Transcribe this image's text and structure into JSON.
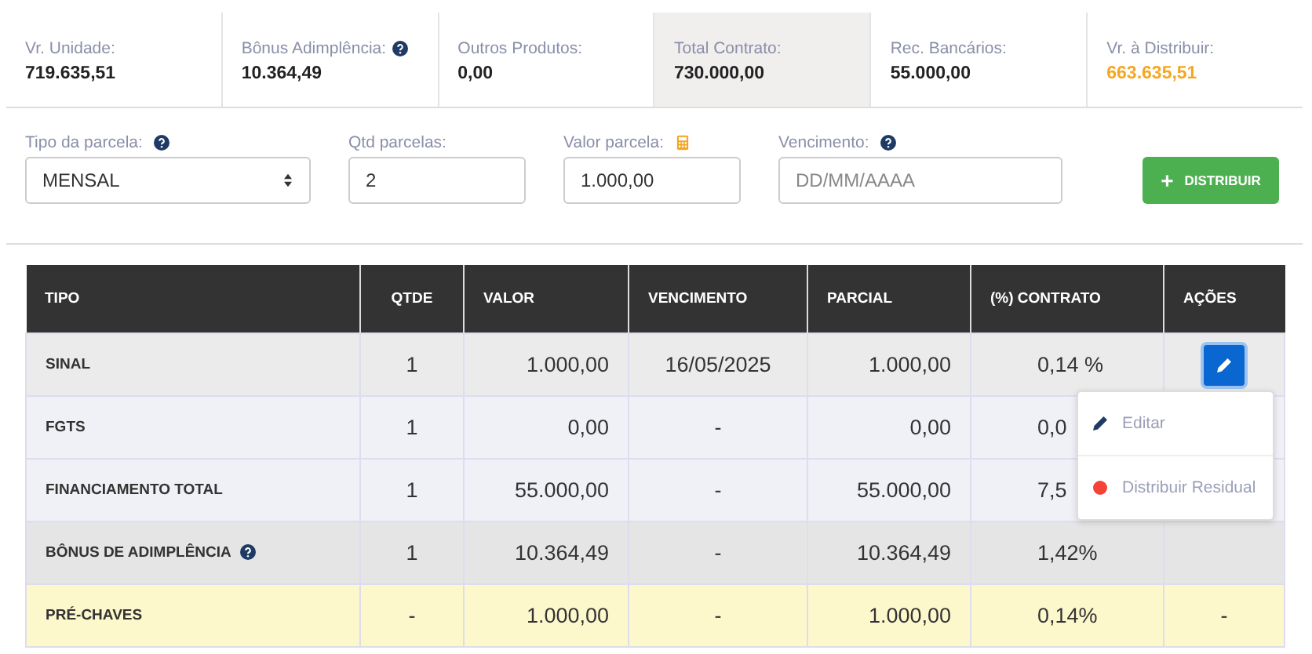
{
  "summary": [
    {
      "label": "Vr. Unidade:",
      "value": "719.635,51",
      "help": false,
      "shaded": false,
      "accent": false
    },
    {
      "label": "Bônus Adimplência:",
      "value": "10.364,49",
      "help": true,
      "shaded": false,
      "accent": false
    },
    {
      "label": "Outros Produtos:",
      "value": "0,00",
      "help": false,
      "shaded": false,
      "accent": false
    },
    {
      "label": "Total Contrato:",
      "value": "730.000,00",
      "help": false,
      "shaded": true,
      "accent": false
    },
    {
      "label": "Rec. Bancários:",
      "value": "55.000,00",
      "help": false,
      "shaded": false,
      "accent": false
    },
    {
      "label": "Vr. à Distribuir:",
      "value": "663.635,51",
      "help": false,
      "shaded": false,
      "accent": true
    }
  ],
  "form": {
    "fields": [
      {
        "kind": "select",
        "label": "Tipo da parcela:",
        "help": true,
        "value": "MENSAL"
      },
      {
        "kind": "input",
        "label": "Qtd parcelas:",
        "help": false,
        "value": "2"
      },
      {
        "kind": "money",
        "label": "Valor parcela:",
        "help": false,
        "value": "1.000,00"
      },
      {
        "kind": "input",
        "label": "Vencimento:",
        "help": true,
        "placeholder": "DD/MM/AAAA"
      }
    ],
    "button": {
      "glyph": "+",
      "label": "DISTRIBUIR"
    }
  },
  "table": {
    "columns": [
      "TIPO",
      "QTDE",
      "VALOR",
      "VENCIMENTO",
      "PARCIAL",
      "(%) CONTRATO",
      "AÇÕES"
    ],
    "rows": [
      {
        "help": false,
        "highlight": false,
        "cells": [
          "SINAL",
          "1",
          "1.000,00",
          "16/05/2025",
          "1.000,00",
          "0,14 %"
        ],
        "edit": {
          "expanded": true
        }
      },
      {
        "help": false,
        "highlight": false,
        "cells": [
          "FGTS",
          "1",
          "0,00",
          "-",
          "0,00",
          "0,0"
        ]
      },
      {
        "help": false,
        "highlight": false,
        "cells": [
          "FINANCIAMENTO TOTAL",
          "1",
          "55.000,00",
          "-",
          "55.000,00",
          "7,5"
        ]
      },
      {
        "help": true,
        "highlight": false,
        "cells": [
          "BÔNUS DE ADIMPLÊNCIA",
          "1",
          "10.364,49",
          "-",
          "10.364,49",
          "1,42%"
        ]
      },
      {
        "help": false,
        "highlight": true,
        "cells": [
          "PRÉ-CHAVES",
          "-",
          "1.000,00",
          "-",
          "1.000,00",
          "0,14%",
          "-"
        ]
      }
    ]
  },
  "action_menu": [
    {
      "kind": "edit",
      "label": "Editar"
    },
    {
      "kind": "residual",
      "label": "Distribuir Residual"
    }
  ]
}
